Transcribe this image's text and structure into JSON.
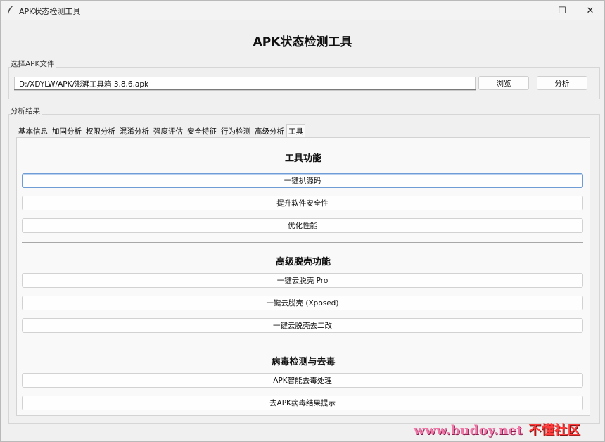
{
  "window": {
    "title": "APK状态检测工具",
    "controls": {
      "minimize": "—",
      "maximize": "☐",
      "close": "✕"
    }
  },
  "heading": "APK状态检测工具",
  "file_section": {
    "label": "选择APK文件",
    "path_value": "D:/XDYLW/APK/澎湃工具箱 3.8.6.apk",
    "browse_label": "浏览",
    "analyze_label": "分析"
  },
  "results": {
    "label": "分析结果",
    "tabs": [
      {
        "label": "基本信息"
      },
      {
        "label": "加固分析"
      },
      {
        "label": "权限分析"
      },
      {
        "label": "混淆分析"
      },
      {
        "label": "强度评估"
      },
      {
        "label": "安全特征"
      },
      {
        "label": "行为检测"
      },
      {
        "label": "高级分析"
      },
      {
        "label": "工具"
      }
    ],
    "active_tab": "工具"
  },
  "tools": {
    "section1": {
      "title": "工具功能",
      "buttons": [
        {
          "label": "一键扒源码"
        },
        {
          "label": "提升软件安全性"
        },
        {
          "label": "优化性能"
        }
      ]
    },
    "section2": {
      "title": "高级脱壳功能",
      "buttons": [
        {
          "label": "一键云脱壳 Pro"
        },
        {
          "label": "一键云脱壳 (Xposed)"
        },
        {
          "label": "一键云脱壳去二改"
        }
      ]
    },
    "section3": {
      "title": "病毒检测与去毒",
      "buttons": [
        {
          "label": "APK智能去毒处理"
        },
        {
          "label": "去APK病毒结果提示"
        }
      ]
    }
  },
  "watermark": {
    "url": "www.budoy.net",
    "name": "不懂社区"
  },
  "colors": {
    "focus_border": "#6f9cd4",
    "watermark_pink": "#f078a8",
    "watermark_red": "#ff3b3b"
  }
}
